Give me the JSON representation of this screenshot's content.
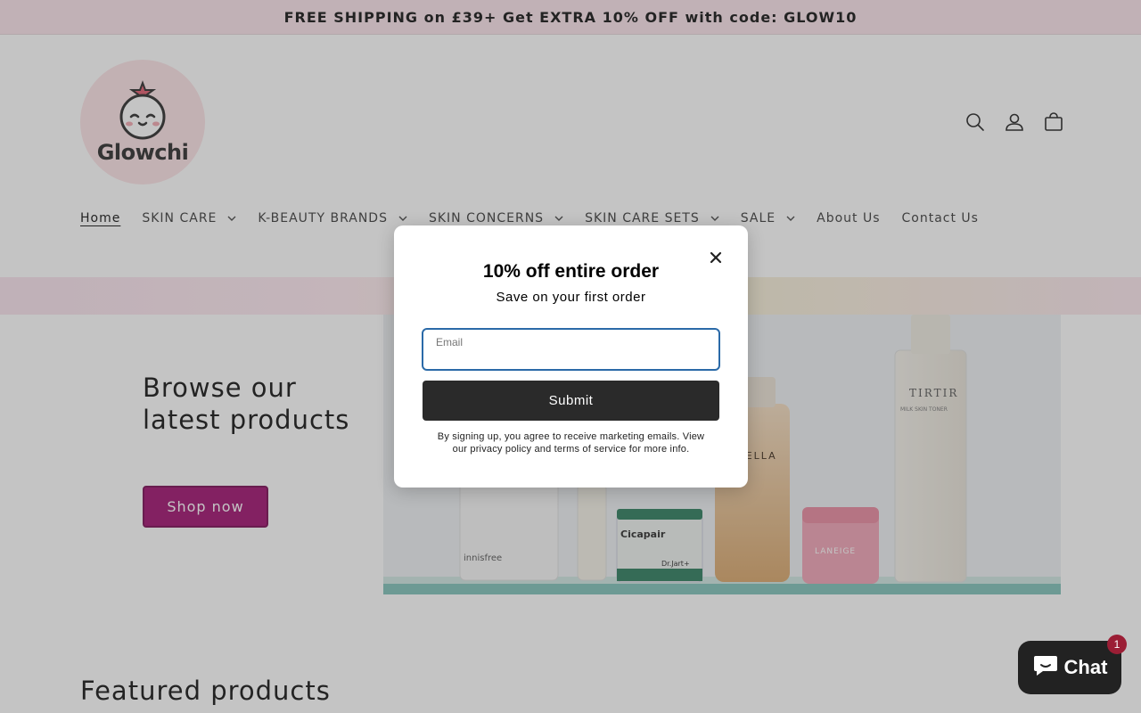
{
  "announcement": {
    "text": "FREE SHIPPING on £39+ Get EXTRA 10% OFF with code: GLOW10"
  },
  "header": {
    "logo_text": "Glowchi",
    "icons": [
      "search-icon",
      "account-icon",
      "cart-icon"
    ]
  },
  "nav": {
    "items": [
      {
        "label": "Home",
        "active": true,
        "dropdown": false
      },
      {
        "label": "SKIN CARE",
        "active": false,
        "dropdown": true
      },
      {
        "label": "K-BEAUTY BRANDS",
        "active": false,
        "dropdown": true
      },
      {
        "label": "SKIN CONCERNS",
        "active": false,
        "dropdown": true
      },
      {
        "label": "SKIN CARE SETS",
        "active": false,
        "dropdown": true
      },
      {
        "label": "SALE",
        "active": false,
        "dropdown": true
      },
      {
        "label": "About Us",
        "active": false,
        "dropdown": false
      },
      {
        "label": "Contact Us",
        "active": false,
        "dropdown": false
      }
    ]
  },
  "hero": {
    "title": "Browse our latest products",
    "button_label": "Shop now",
    "product_labels": [
      "innisfree",
      "Cicapair",
      "Dr.Jart+",
      "TIRTIR",
      "MILK SKIN TONER",
      "LANEIGE",
      "TELLA"
    ]
  },
  "featured": {
    "title": "Featured products"
  },
  "modal": {
    "title": "10% off entire order",
    "subtitle": "Save on your first order",
    "email_label": "Email",
    "email_value": "",
    "submit_label": "Submit",
    "legal": "By signing up, you agree to receive marketing emails. View our privacy policy and terms of service for more info."
  },
  "chat": {
    "label": "Chat",
    "badge": "1"
  },
  "colors": {
    "brand": "#a0106f",
    "announcement_bg": "#fbe4ea",
    "submit_bg": "#2a2a2a"
  }
}
